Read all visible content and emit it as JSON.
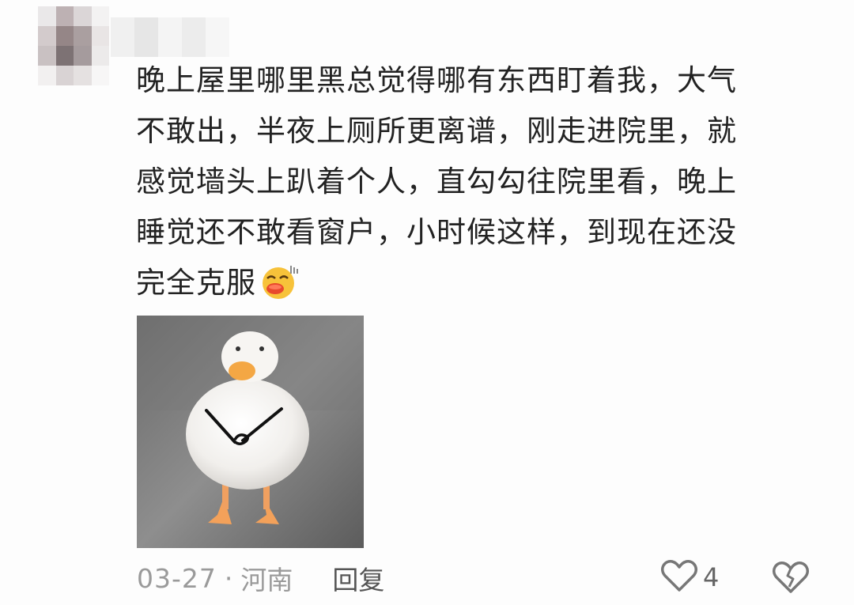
{
  "comment": {
    "lines": [
      "晚上屋里哪里黑总觉得哪有东西盯着我，大气",
      "不敢出，半夜上厕所更离谱，刚走进院里，就",
      "感觉墙头上趴着个人，直勾勾往院里看，晚上",
      "睡觉还不敢看窗户，小时候这样，到现在还没",
      "完全克服"
    ],
    "emoji": "kiss-face-emoji",
    "image": "duck-with-hands-photo"
  },
  "footer": {
    "date": "03-27",
    "separator": "·",
    "location": "河南",
    "reply_label": "回复",
    "like_count": "4",
    "like_icon": "heart-icon",
    "dislike_icon": "broken-heart-icon"
  },
  "colors": {
    "text": "#222222",
    "meta": "#9a9a9a",
    "background": "#fdfdfd"
  }
}
